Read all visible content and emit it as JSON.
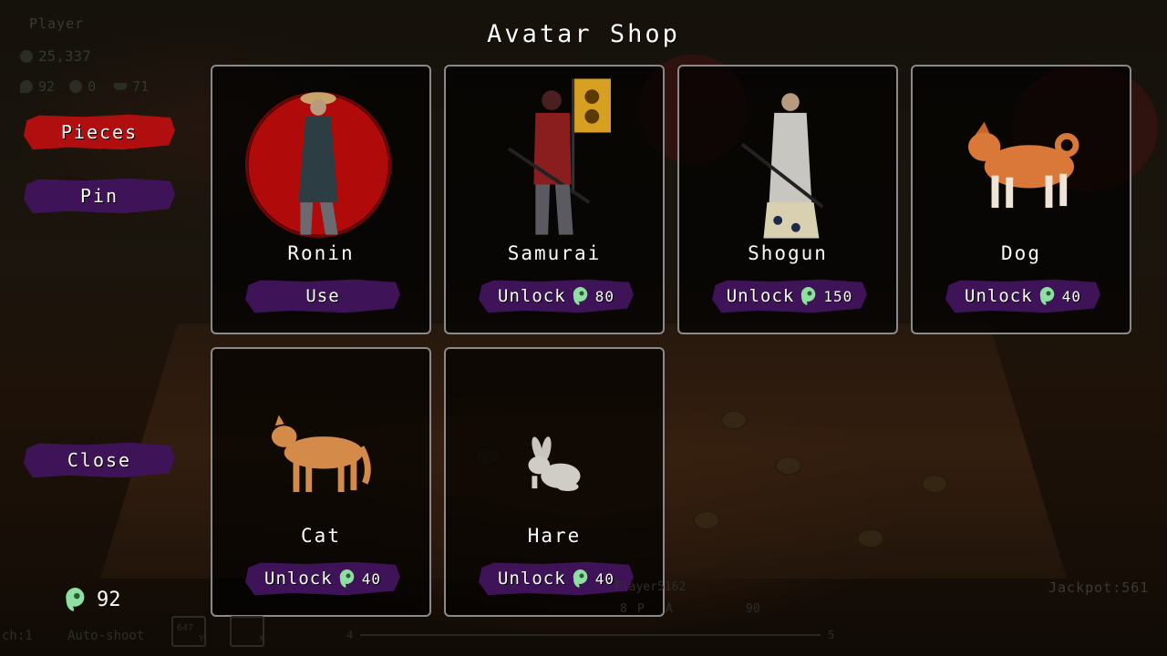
{
  "title": "Avatar Shop",
  "hud": {
    "player_name": "Player",
    "coins": "25,337",
    "gems": "92",
    "item_b": "0",
    "item_c": "71"
  },
  "menu": {
    "pieces_label": "Pieces",
    "pin_label": "Pin",
    "close_label": "Close"
  },
  "avatars": [
    {
      "name": "Ronin",
      "action": "Use",
      "price": ""
    },
    {
      "name": "Samurai",
      "action": "Unlock",
      "price": "80"
    },
    {
      "name": "Shogun",
      "action": "Unlock",
      "price": "150"
    },
    {
      "name": "Dog",
      "action": "Unlock",
      "price": "40"
    },
    {
      "name": "Cat",
      "action": "Unlock",
      "price": "40"
    },
    {
      "name": "Hare",
      "action": "Unlock",
      "price": "40"
    }
  ],
  "footer": {
    "gem_count": "92",
    "ch_label": "ch:1",
    "auto_shoot_label": "Auto-shoot",
    "key_y_value": "647",
    "key_y_label": "Y",
    "key_x_label": "X",
    "slider_min": "4",
    "slider_max": "5",
    "opponent_name": "Player5162",
    "opponent_coins": "8",
    "opponent_gems": "90",
    "marker_p": "P",
    "marker_a": "A",
    "jackpot": "Jackpot:561"
  },
  "colors": {
    "accent_red": "#b10f0f",
    "accent_purple": "#3e1358",
    "gem_green": "#8fe0a0",
    "card_border": "#8a8a8a"
  },
  "icons": [
    "magatama-gem-icon",
    "coin-icon",
    "daruma-icon",
    "bowl-icon"
  ]
}
